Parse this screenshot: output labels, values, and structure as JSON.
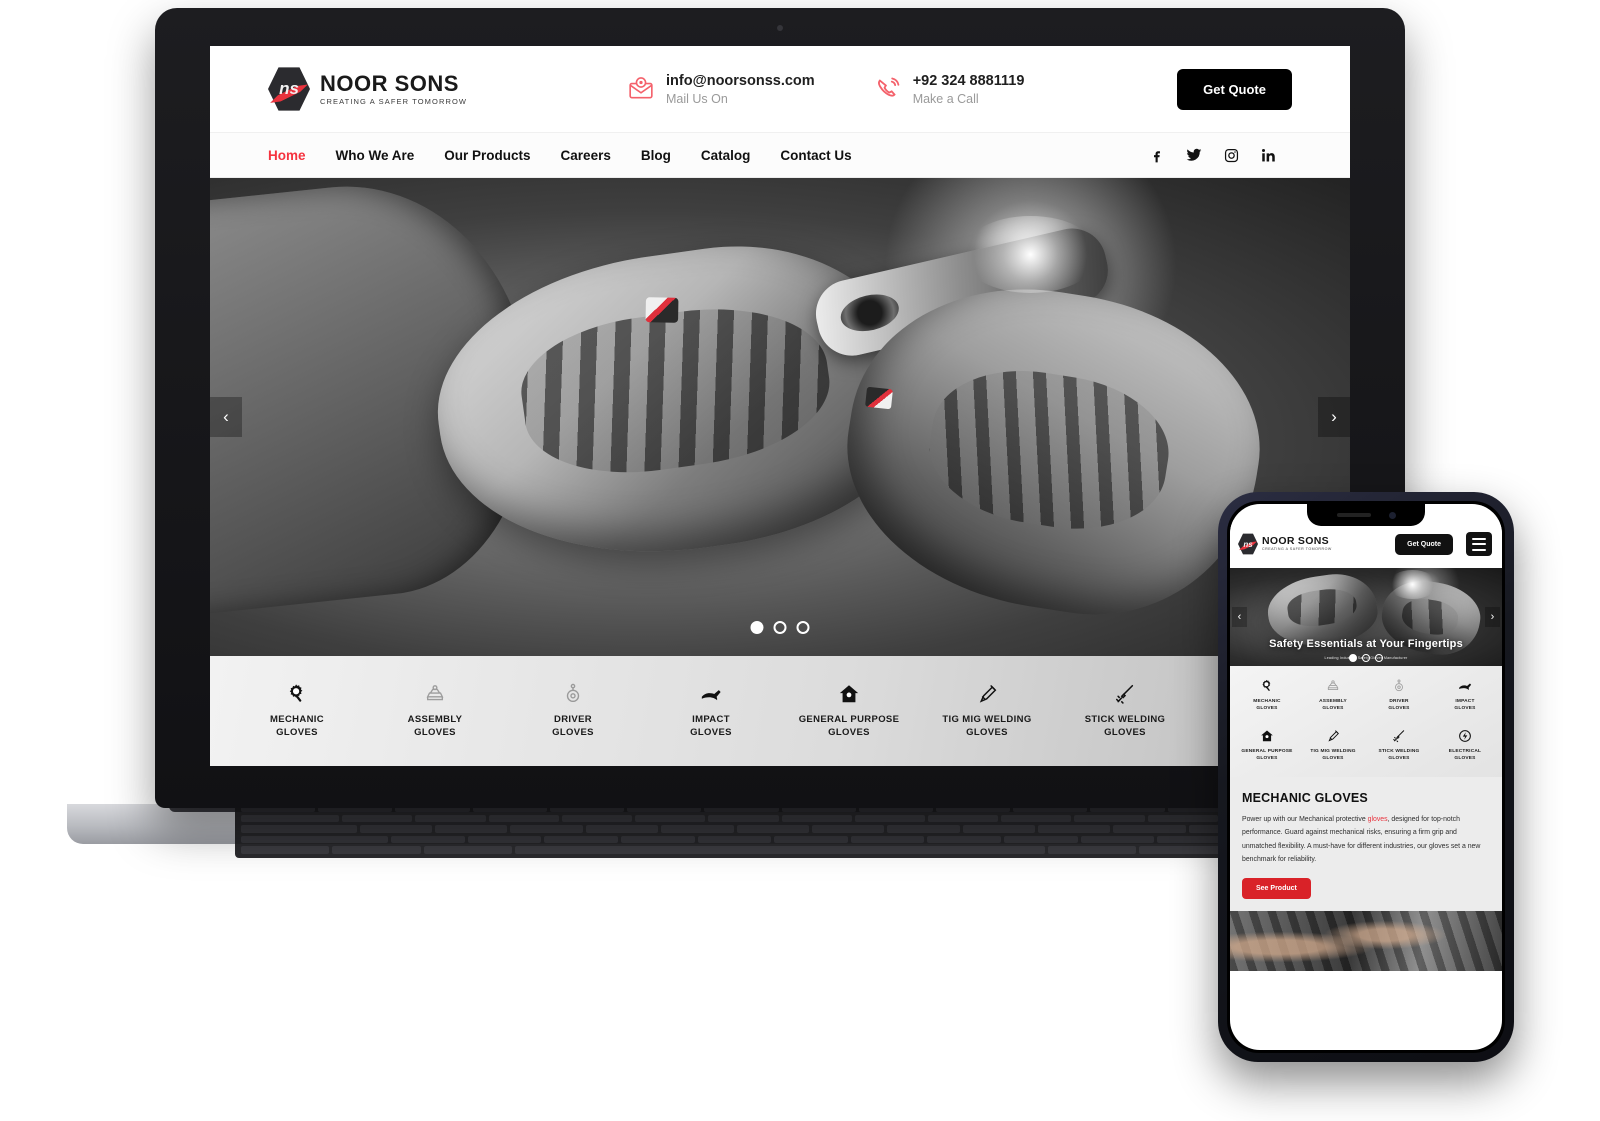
{
  "brand": {
    "name": "NOOR SONS",
    "tagline": "CREATING A SAFER TOMORROW",
    "monogram": "ns",
    "accent_color": "#e8323d",
    "dark_color": "#111111"
  },
  "header": {
    "email": {
      "value": "info@noorsonss.com",
      "label": "Mail Us On",
      "icon": "mail-icon"
    },
    "phone": {
      "value": "+92 324 8881119",
      "label": "Make a Call",
      "icon": "phone-icon"
    },
    "quote_button": "Get Quote"
  },
  "nav": {
    "items": [
      {
        "label": "Home",
        "active": true
      },
      {
        "label": "Who We Are",
        "active": false
      },
      {
        "label": "Our Products",
        "active": false
      },
      {
        "label": "Careers",
        "active": false
      },
      {
        "label": "Blog",
        "active": false
      },
      {
        "label": "Catalog",
        "active": false
      },
      {
        "label": "Contact Us",
        "active": false
      }
    ],
    "socials": [
      {
        "name": "facebook-icon"
      },
      {
        "name": "twitter-icon"
      },
      {
        "name": "instagram-icon"
      },
      {
        "name": "linkedin-icon"
      }
    ]
  },
  "hero": {
    "prev_arrow": "‹",
    "next_arrow": "›",
    "dots": [
      true,
      false,
      false
    ],
    "image_alt": "Hands wearing grey mechanic safety gloves holding pliers over an engine"
  },
  "categories": [
    {
      "label": "MECHANIC\nGLOVES",
      "icon": "gear-gloves-icon",
      "dim": false
    },
    {
      "label": "ASSEMBLY\nGLOVES",
      "icon": "assembly-gloves-icon",
      "dim": true
    },
    {
      "label": "DRIVER\nGLOVES",
      "icon": "driver-gloves-icon",
      "dim": true
    },
    {
      "label": "IMPACT\nGLOVES",
      "icon": "impact-gloves-icon",
      "dim": false
    },
    {
      "label": "GENERAL PURPOSE\nGLOVES",
      "icon": "general-gloves-icon",
      "dim": false
    },
    {
      "label": "TIG MIG WELDING\nGLOVES",
      "icon": "tig-mig-welding-icon",
      "dim": false
    },
    {
      "label": "STICK WELDING\nGLOVES",
      "icon": "stick-welding-icon",
      "dim": false
    },
    {
      "label": "ELECTRICAL\nGLOVES",
      "icon": "electrical-gloves-icon",
      "dim": false
    }
  ],
  "categories_desktop_labels": [
    "MECHANIC GLOVES",
    "ASSEMBLY GLOVES",
    "DRIVER GLOVES",
    "IMPACT GLOVES",
    "GENERAL PURPOSE GLOVES",
    "TIG MIG WELDING GLOVES",
    "STICK WELDING GLOVES",
    "ELECTRICAL GLOVES"
  ],
  "mobile": {
    "quote_button": "Get Quote",
    "menu_icon": "hamburger-menu-icon",
    "hero_caption": "Safety Essentials at Your Fingertips",
    "hero_subcaption": "Leading Industrial Safety Gloves Manufacturer",
    "hero_dots": [
      true,
      false,
      false
    ],
    "section": {
      "title": "MECHANIC GLOVES",
      "body_before": "Power up with our Mechanical protective ",
      "body_link": "gloves",
      "body_after": ", designed for top-notch performance. Guard against mechanical risks, ensuring a firm grip and unmatched flexibility. A must-have for different industries, our gloves set a new benchmark for reliability.",
      "cta": "See Product"
    }
  }
}
